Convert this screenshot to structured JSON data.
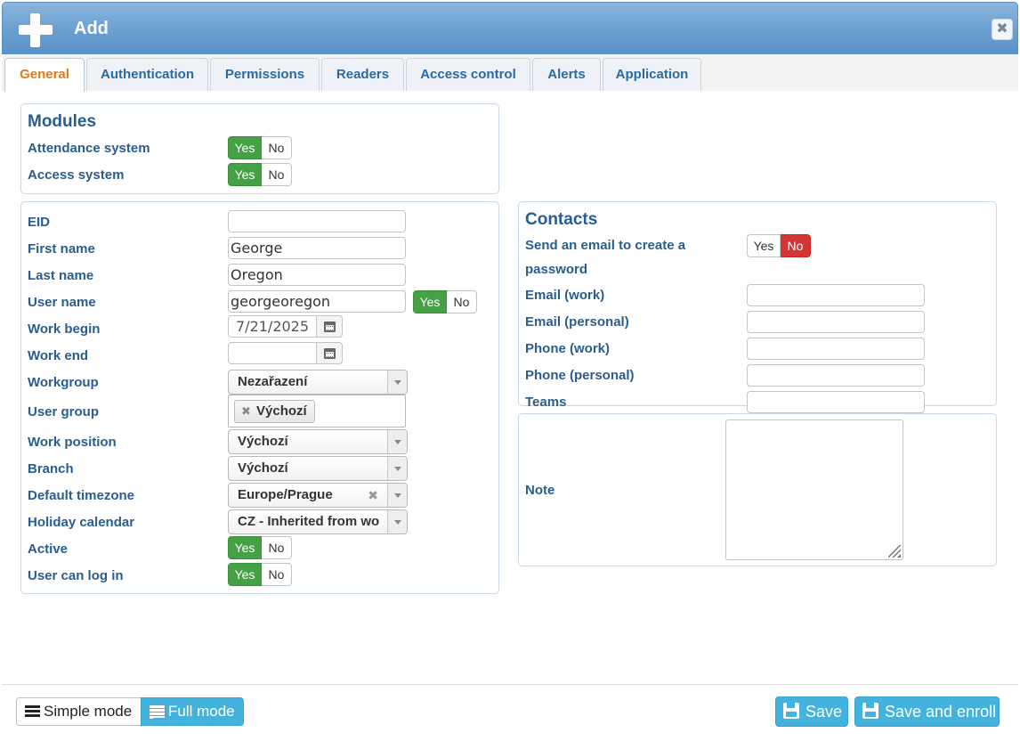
{
  "dialog": {
    "title": "Add",
    "close_label": "✖"
  },
  "tabs": [
    {
      "label": "General"
    },
    {
      "label": "Authentication"
    },
    {
      "label": "Permissions"
    },
    {
      "label": "Readers"
    },
    {
      "label": "Access control"
    },
    {
      "label": "Alerts"
    },
    {
      "label": "Application"
    }
  ],
  "toggle_labels": {
    "yes": "Yes",
    "no": "No"
  },
  "modules": {
    "title": "Modules",
    "attendance": {
      "label": "Attendance system",
      "value": "Yes"
    },
    "access": {
      "label": "Access system",
      "value": "Yes"
    }
  },
  "form": {
    "eid": {
      "label": "EID",
      "value": ""
    },
    "first_name": {
      "label": "First name",
      "value": "George"
    },
    "last_name": {
      "label": "Last name",
      "value": "Oregon"
    },
    "user_name": {
      "label": "User name",
      "value": "georgeoregon",
      "toggle": "Yes"
    },
    "work_begin": {
      "label": "Work begin",
      "value": "7/21/2025"
    },
    "work_end": {
      "label": "Work end",
      "value": ""
    },
    "workgroup": {
      "label": "Workgroup",
      "value": "Nezařazení"
    },
    "user_group": {
      "label": "User group",
      "chips": [
        "Výchozí"
      ]
    },
    "work_position": {
      "label": "Work position",
      "value": "Výchozí"
    },
    "branch": {
      "label": "Branch",
      "value": "Výchozí"
    },
    "default_timezone": {
      "label": "Default timezone",
      "value": "Europe/Prague"
    },
    "holiday_calendar": {
      "label": "Holiday calendar",
      "value": "CZ - Inherited from wo"
    },
    "active": {
      "label": "Active",
      "value": "Yes"
    },
    "can_log_in": {
      "label": "User can log in",
      "value": "Yes"
    }
  },
  "contacts": {
    "title": "Contacts",
    "send_email": {
      "label_line1": "Send an email to create a",
      "label_line2": "password",
      "value": "No"
    },
    "email_work": {
      "label": "Email (work)",
      "value": ""
    },
    "email_personal": {
      "label": "Email (personal)",
      "value": ""
    },
    "phone_work": {
      "label": "Phone (work)",
      "value": ""
    },
    "phone_personal": {
      "label": "Phone (personal)",
      "value": ""
    },
    "teams": {
      "label": "Teams",
      "value": ""
    }
  },
  "note": {
    "label": "Note",
    "value": ""
  },
  "footer": {
    "simple_mode": "Simple mode",
    "full_mode": "Full mode",
    "save": "Save",
    "save_enroll": "Save and enroll"
  }
}
